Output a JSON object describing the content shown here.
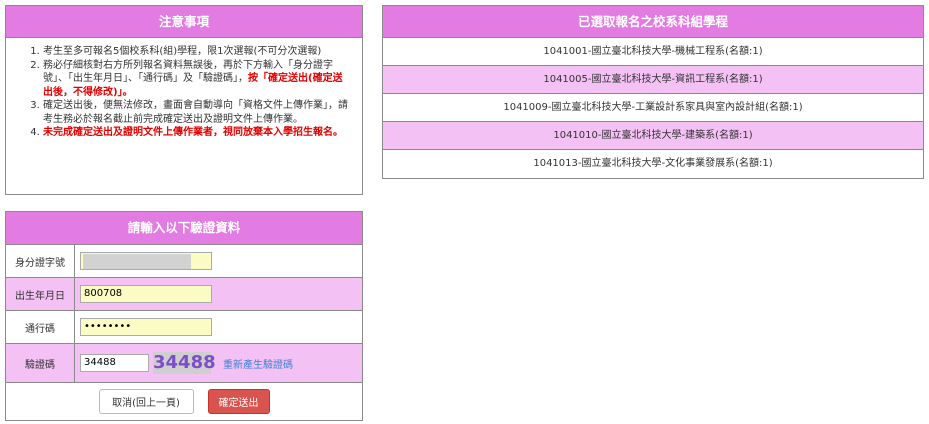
{
  "notice": {
    "title": "注意事項",
    "items": [
      {
        "parts": [
          {
            "text": "考生至多可報名5個校系科(組)學程，限1次選報(不可分次選報)",
            "red": false
          }
        ]
      },
      {
        "parts": [
          {
            "text": "務必仔細核對右方所列報名資料無誤後，再於下方輸入「身分證字號」、「出生年月日」、「通行碼」及「驗證碼」，",
            "red": false
          },
          {
            "text": "按「確定送出(確定送出後，不得修改)」。",
            "red": true
          }
        ]
      },
      {
        "parts": [
          {
            "text": "確定送出後，便無法修改，畫面會自動導向「資格文件上傳作業」，請考生務必於報名截止前完成確定送出及證明文件上傳作業。",
            "red": false
          }
        ]
      },
      {
        "parts": [
          {
            "text": "未完成確定送出及證明文件上傳作業者，視同放棄本入學招生報名。",
            "red": true
          }
        ]
      }
    ]
  },
  "selected": {
    "title": "已選取報名之校系科組學程",
    "rows": [
      "1041001-國立臺北科技大學-機械工程系(名額:1)",
      "1041005-國立臺北科技大學-資訊工程系(名額:1)",
      "1041009-國立臺北科技大學-工業設計系家具與室內設計組(名額:1)",
      "1041010-國立臺北科技大學-建築系(名額:1)",
      "1041013-國立臺北科技大學-文化事業發展系(名額:1)"
    ]
  },
  "verify": {
    "title": "請輸入以下驗證資料",
    "id_label": "身分證字號",
    "id_value": "",
    "birth_label": "出生年月日",
    "birth_value": "800708",
    "pass_label": "通行碼",
    "pass_value": "••••••••",
    "captcha_label": "驗證碼",
    "captcha_value": "34488",
    "captcha_image_text": "34488",
    "refresh_label": "重新產生驗證碼",
    "cancel_label": "取消(回上一頁)",
    "submit_label": "確定送出"
  },
  "colors": {
    "header": "#e27be2",
    "row_alt": "#f4c1f4",
    "input_bg": "#fbfbc4",
    "submit": "#d9534f",
    "link": "#3f82d4",
    "notice_red": "#e00000"
  }
}
